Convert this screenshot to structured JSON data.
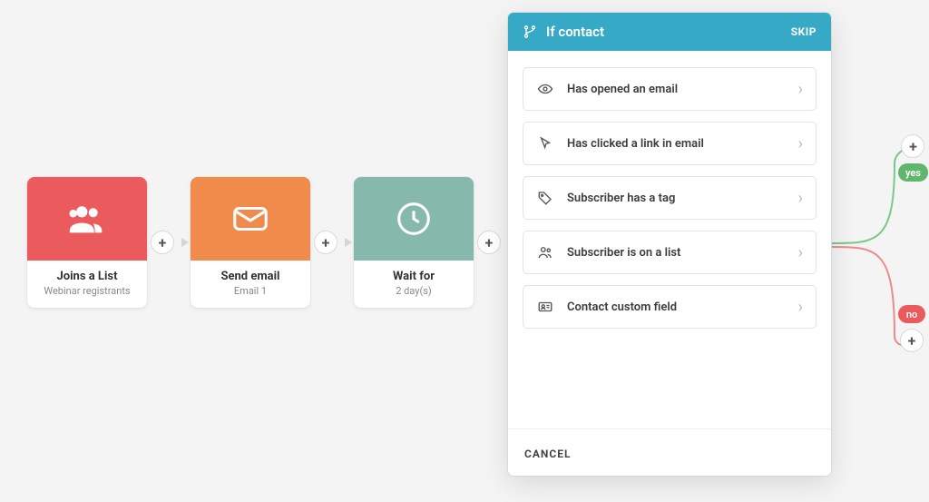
{
  "nodes": {
    "joins": {
      "title": "Joins a List",
      "sub": "Webinar registrants"
    },
    "send": {
      "title": "Send email",
      "sub": "Email 1"
    },
    "wait": {
      "title": "Wait for",
      "sub": "2 day(s)"
    }
  },
  "panel": {
    "title": "If contact",
    "skip": "SKIP",
    "cancel": "CANCEL",
    "options": {
      "opened": "Has opened an email",
      "clicked": "Has clicked a link in email",
      "tag": "Subscriber has a tag",
      "list": "Subscriber is on a list",
      "field": "Contact custom field"
    }
  },
  "branches": {
    "yes": "yes",
    "no": "no"
  },
  "glyphs": {
    "plus": "+",
    "chevron": "›"
  }
}
